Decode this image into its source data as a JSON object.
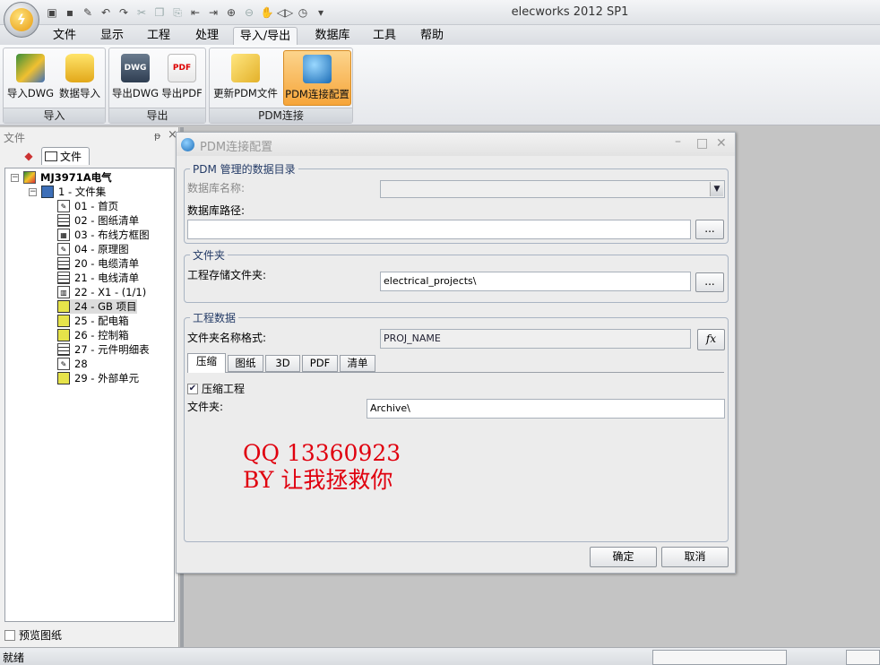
{
  "app": {
    "title": "elecworks 2012 SP1"
  },
  "menu": {
    "tabs": [
      "文件",
      "显示",
      "工程",
      "处理",
      "导入/导出",
      "数据库",
      "工具",
      "帮助"
    ],
    "active": "导入/导出"
  },
  "ribbon": {
    "groups": [
      {
        "label": "导入",
        "buttons": [
          "导入DWG",
          "数据导入"
        ]
      },
      {
        "label": "导出",
        "buttons": [
          "导出DWG",
          "导出PDF"
        ]
      },
      {
        "label": "PDM连接",
        "buttons": [
          "更新PDM文件",
          "PDM连接配置"
        ]
      }
    ],
    "icons": {
      "dwg": "DWG",
      "pdf": "PDF"
    }
  },
  "panel": {
    "title": "文件",
    "pin": "ᵽ",
    "close": "×",
    "tab": "文件",
    "tree": {
      "root": "MJ3971A电气",
      "set": "1 - 文件集",
      "items": [
        "01 - 首页",
        "02 - 图纸清单",
        "03 - 布线方框图",
        "04 - 原理图",
        "20 - 电缆清单",
        "21 - 电线清单",
        "22 - X1 - (1/1)",
        "24 - GB 项目",
        "25 - 配电箱",
        "26 - 控制箱",
        "27 - 元件明细表",
        "28",
        "29 - 外部单元"
      ]
    },
    "preview_label": "预览图纸"
  },
  "status": {
    "text": "就绪"
  },
  "dialog": {
    "title": "PDM连接配置",
    "group1": {
      "legend": "PDM 管理的数据目录",
      "db_name_label": "数据库名称:",
      "db_path_label": "数据库路径:",
      "db_path_value": "",
      "browse": "..."
    },
    "group2": {
      "legend": "文件夹",
      "folder_label": "工程存储文件夹:",
      "folder_value": "electrical_projects\\",
      "browse": "..."
    },
    "group3": {
      "legend": "工程数据",
      "format_label": "文件夹名称格式:",
      "format_value": "PROJ_NAME",
      "fx": "fx",
      "tabs": [
        "压缩",
        "图纸",
        "3D",
        "PDF",
        "清单"
      ],
      "compress_check": "压缩工程",
      "folder_label": "文件夹:",
      "folder_value": "Archive\\"
    },
    "watermark": {
      "line1": "QQ 13360923",
      "line2": "BY 让我拯救你"
    },
    "ok": "确定",
    "cancel": "取消"
  }
}
